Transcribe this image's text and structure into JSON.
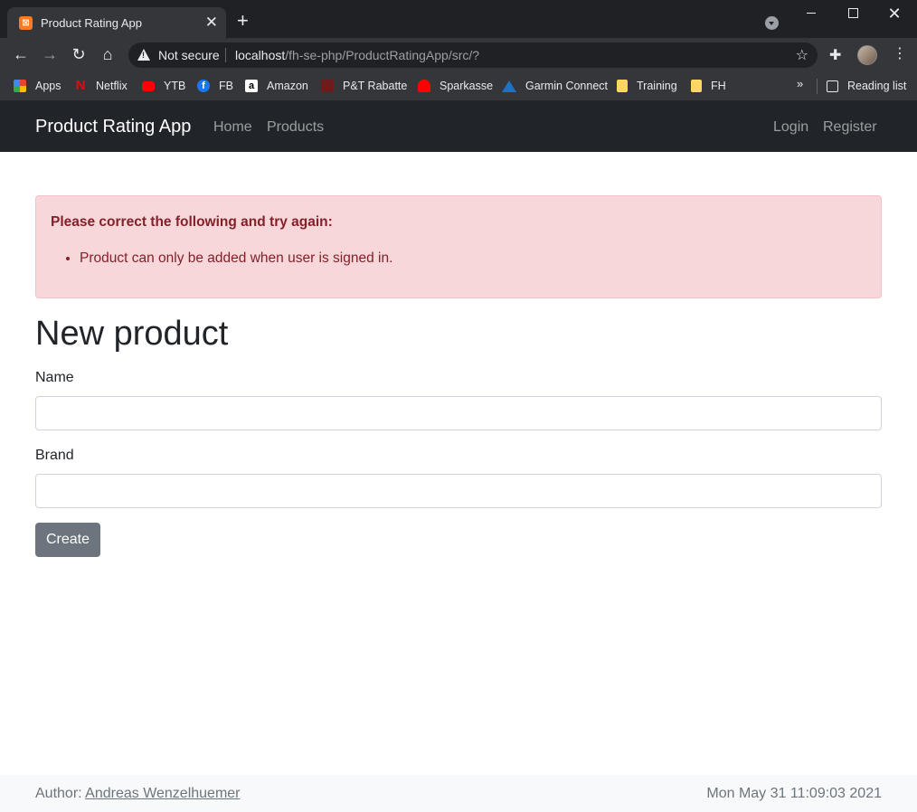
{
  "browser": {
    "tab_title": "Product Rating App",
    "tab_favicon": "xampp-icon",
    "new_tab": "+",
    "close_tab": "✕",
    "security_label": "Not secure",
    "url_host": "localhost",
    "url_path": "/fh-se-php/ProductRatingApp/src/?",
    "bookmarks": [
      {
        "label": "Apps",
        "icon": "apps-grid-icon",
        "color": "#ea4335"
      },
      {
        "label": "Netflix",
        "icon": "netflix-icon",
        "color": "#e50914"
      },
      {
        "label": "YTB",
        "icon": "youtube-icon",
        "color": "#ff0000"
      },
      {
        "label": "FB",
        "icon": "facebook-icon",
        "color": "#1877f2"
      },
      {
        "label": "Amazon",
        "icon": "amazon-icon",
        "color": "#ffffff"
      },
      {
        "label": "P&T Rabatte",
        "icon": "pt-icon",
        "color": "#8b1a1a"
      },
      {
        "label": "Sparkasse",
        "icon": "sparkasse-icon",
        "color": "#ff0000"
      },
      {
        "label": "Garmin Connect",
        "icon": "garmin-icon",
        "color": "#1a73c9"
      },
      {
        "label": "Training",
        "icon": "folder-icon",
        "color": "#fdd663"
      },
      {
        "label": "FH",
        "icon": "folder-icon",
        "color": "#fdd663"
      }
    ],
    "bookmarks_more": "»",
    "reading_list": "Reading list"
  },
  "navbar": {
    "brand": "Product Rating App",
    "links": [
      "Home",
      "Products"
    ],
    "login": "Login",
    "register": "Register"
  },
  "alert": {
    "title": "Please correct the following and try again:",
    "errors": [
      "Product can only be added when user is signed in."
    ]
  },
  "form": {
    "heading": "New product",
    "name_label": "Name",
    "name_value": "",
    "brand_label": "Brand",
    "brand_value": "",
    "submit_label": "Create"
  },
  "footer": {
    "author_prefix": "Author: ",
    "author_name": "Andreas Wenzelhuemer",
    "timestamp": "Mon May 31 11:09:03 2021"
  },
  "colors": {
    "navbar_bg": "#212529",
    "alert_bg": "#f8d7da",
    "alert_text": "#842029",
    "button_bg": "#6c757d"
  }
}
